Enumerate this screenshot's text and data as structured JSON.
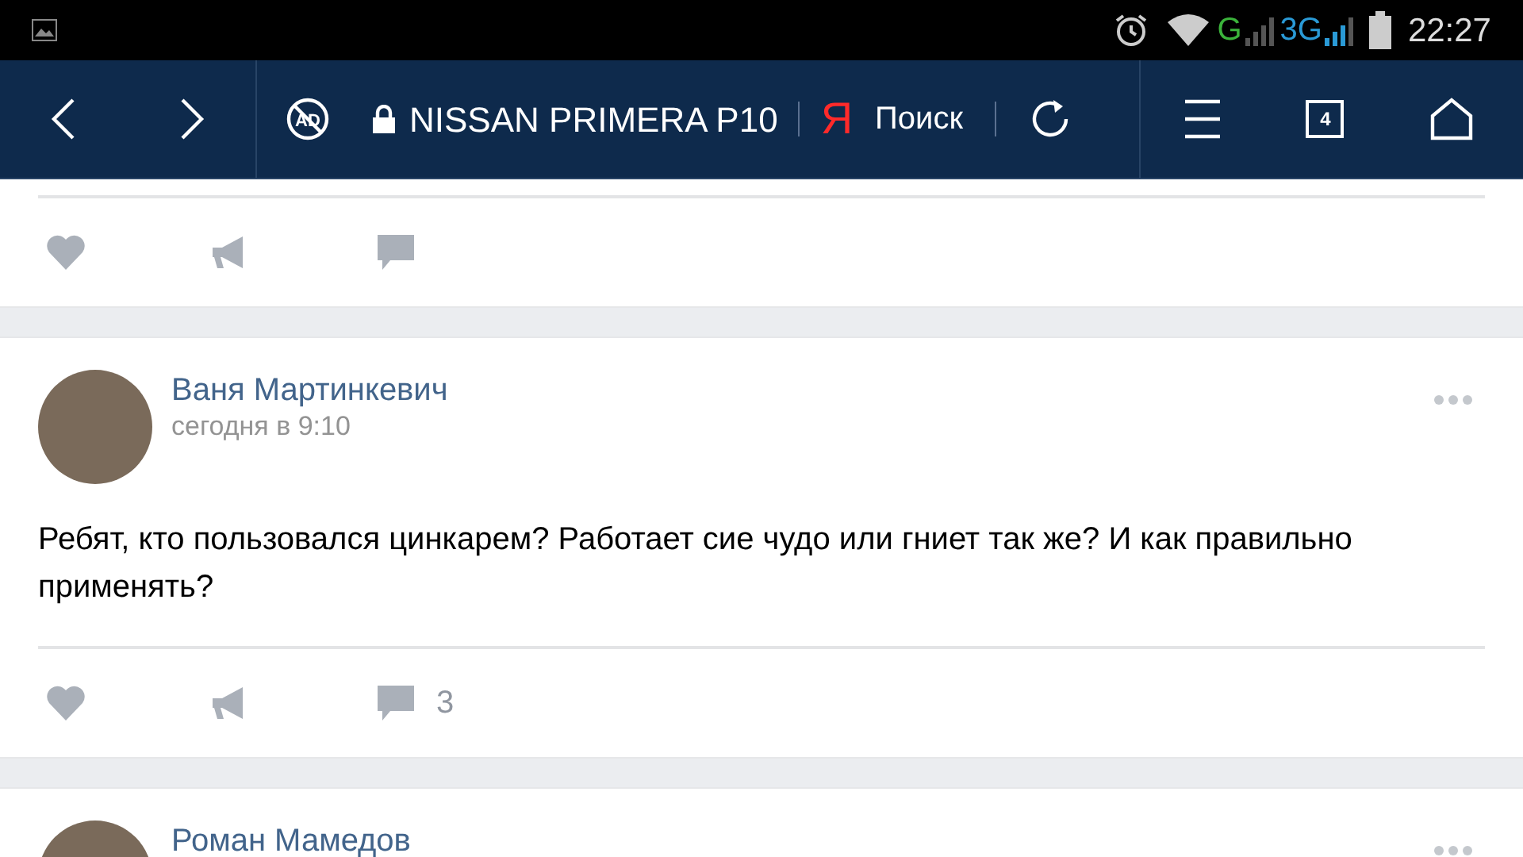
{
  "status_bar": {
    "network_1": "G",
    "network_2": "3G",
    "time": "22:27"
  },
  "toolbar": {
    "address": "NISSAN PRIMERA P10",
    "search_logo": "Я",
    "search_label": "Поиск",
    "tab_count": "4",
    "ad_label": "AD"
  },
  "posts": [
    {
      "kind": "actions_only"
    },
    {
      "kind": "full",
      "author": "Ваня Мартинкевич",
      "time": "сегодня в 9:10",
      "text": "Ребят, кто пользовался цинкарем? Работает сие чудо или гниет так же? И как правильно применять?",
      "comments": "3"
    },
    {
      "kind": "header_only",
      "author": "Роман Мамедов"
    }
  ]
}
